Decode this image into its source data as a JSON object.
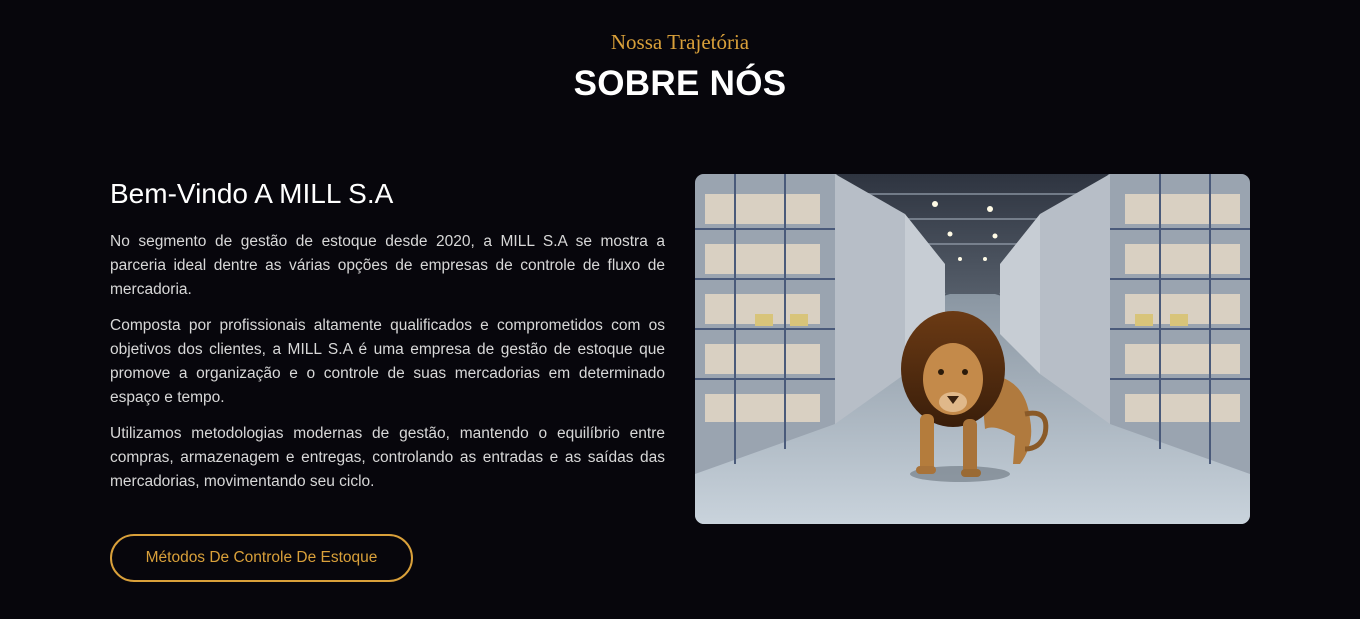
{
  "section": {
    "eyebrow": "Nossa Trajetória",
    "title": "SOBRE NÓS"
  },
  "about": {
    "heading": "Bem-Vindo A MILL S.A",
    "paragraphs": [
      "No segmento de gestão de estoque desde 2020, a MILL S.A se mostra a parceria ideal dentre as várias opções de empresas de controle de fluxo de mercadoria.",
      "Composta por profissionais altamente qualificados e comprometidos com os objetivos dos clientes, a MILL S.A é uma empresa de gestão de estoque que promove a organização e o controle de suas mercadorias em determinado espaço e tempo.",
      "Utilizamos metodologias modernas de gestão, mantendo o equilíbrio entre compras, armazenagem e entregas, controlando as entradas e as saídas das mercadorias, movimentando seu ciclo."
    ],
    "cta_label": "Métodos De Controle De Estoque"
  },
  "image": {
    "alt": "Lion walking through a warehouse aisle",
    "icon": "warehouse-lion-photo"
  },
  "colors": {
    "background": "#07060c",
    "accent": "#d9a03a",
    "text": "#ffffff"
  }
}
